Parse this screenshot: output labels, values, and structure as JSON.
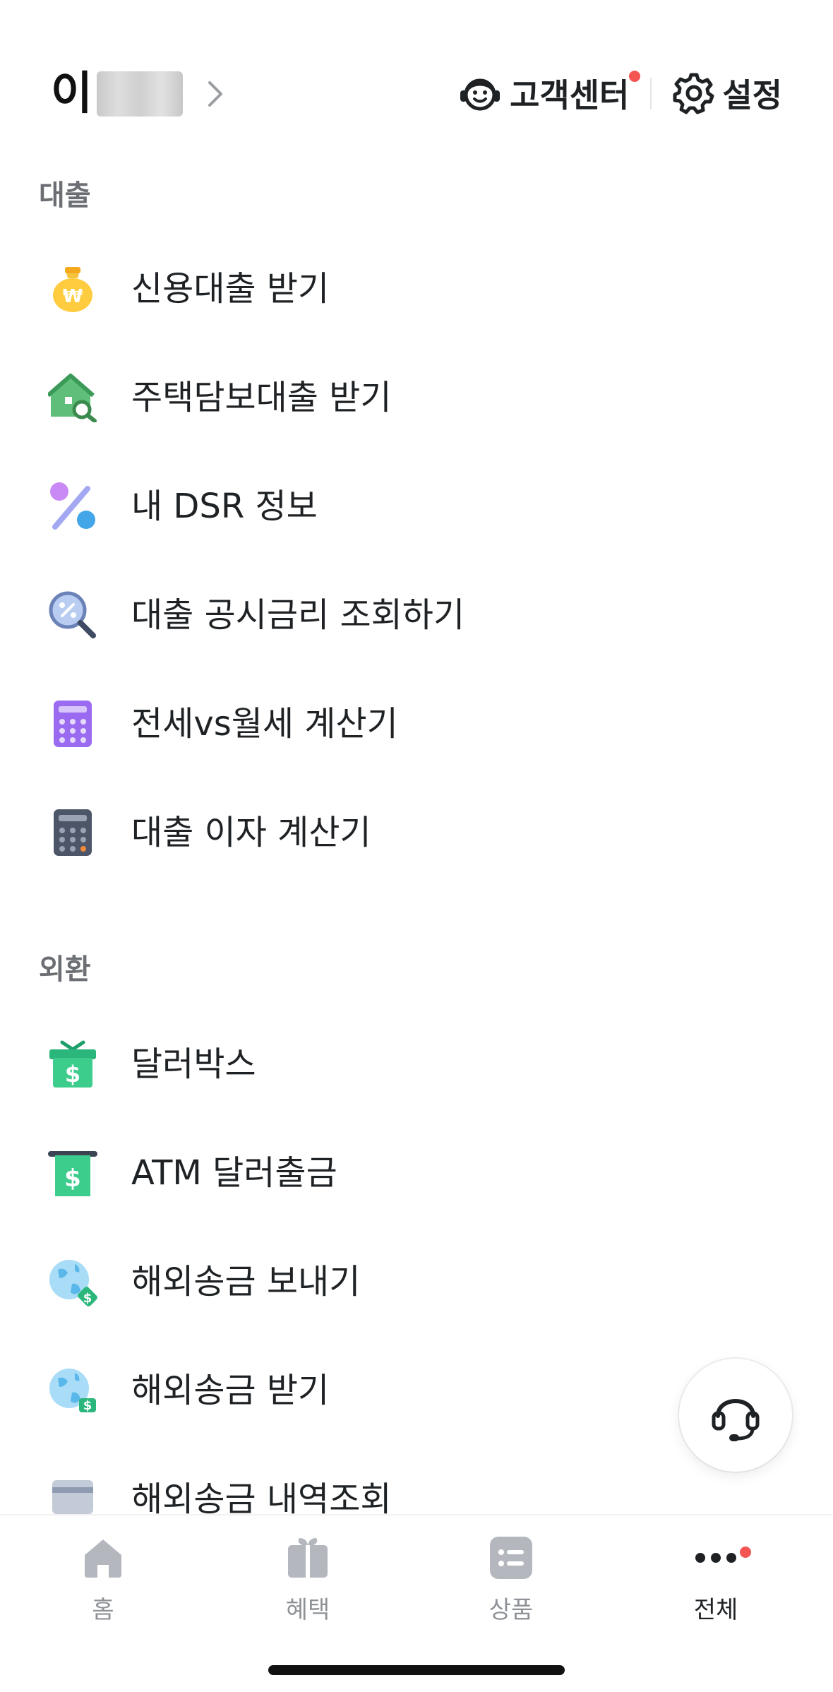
{
  "header": {
    "profile_name": "이",
    "customer_center_label": "고객센터",
    "settings_label": "설정"
  },
  "sections": [
    {
      "title": "대출",
      "items": [
        {
          "label": "신용대출 받기",
          "icon": "money-bag-icon"
        },
        {
          "label": "주택담보대출 받기",
          "icon": "house-search-icon"
        },
        {
          "label": "내 DSR 정보",
          "icon": "percent-icon"
        },
        {
          "label": "대출 공시금리 조회하기",
          "icon": "magnifier-percent-icon"
        },
        {
          "label": "전세vs월세 계산기",
          "icon": "calculator-purple-icon"
        },
        {
          "label": "대출 이자 계산기",
          "icon": "calculator-dark-icon"
        }
      ]
    },
    {
      "title": "외환",
      "items": [
        {
          "label": "달러박스",
          "icon": "dollar-gift-box-icon"
        },
        {
          "label": "ATM 달러출금",
          "icon": "dollar-bill-icon"
        },
        {
          "label": "해외송금 보내기",
          "icon": "globe-send-icon"
        },
        {
          "label": "해외송금 받기",
          "icon": "globe-receive-icon"
        },
        {
          "label": "해외송금 내역조회",
          "icon": "card-list-icon"
        }
      ]
    }
  ],
  "tabbar": {
    "tabs": [
      {
        "label": "홈",
        "icon": "home-icon"
      },
      {
        "label": "혜택",
        "icon": "gift-icon"
      },
      {
        "label": "상품",
        "icon": "product-list-icon"
      },
      {
        "label": "전체",
        "icon": "more-dots-icon"
      }
    ],
    "active_tab": "전체"
  },
  "colors": {
    "notification_dot": "#f45452",
    "tab_inactive": "#8e9297",
    "tab_active": "#1f2225",
    "section_title": "#6b6e73"
  }
}
